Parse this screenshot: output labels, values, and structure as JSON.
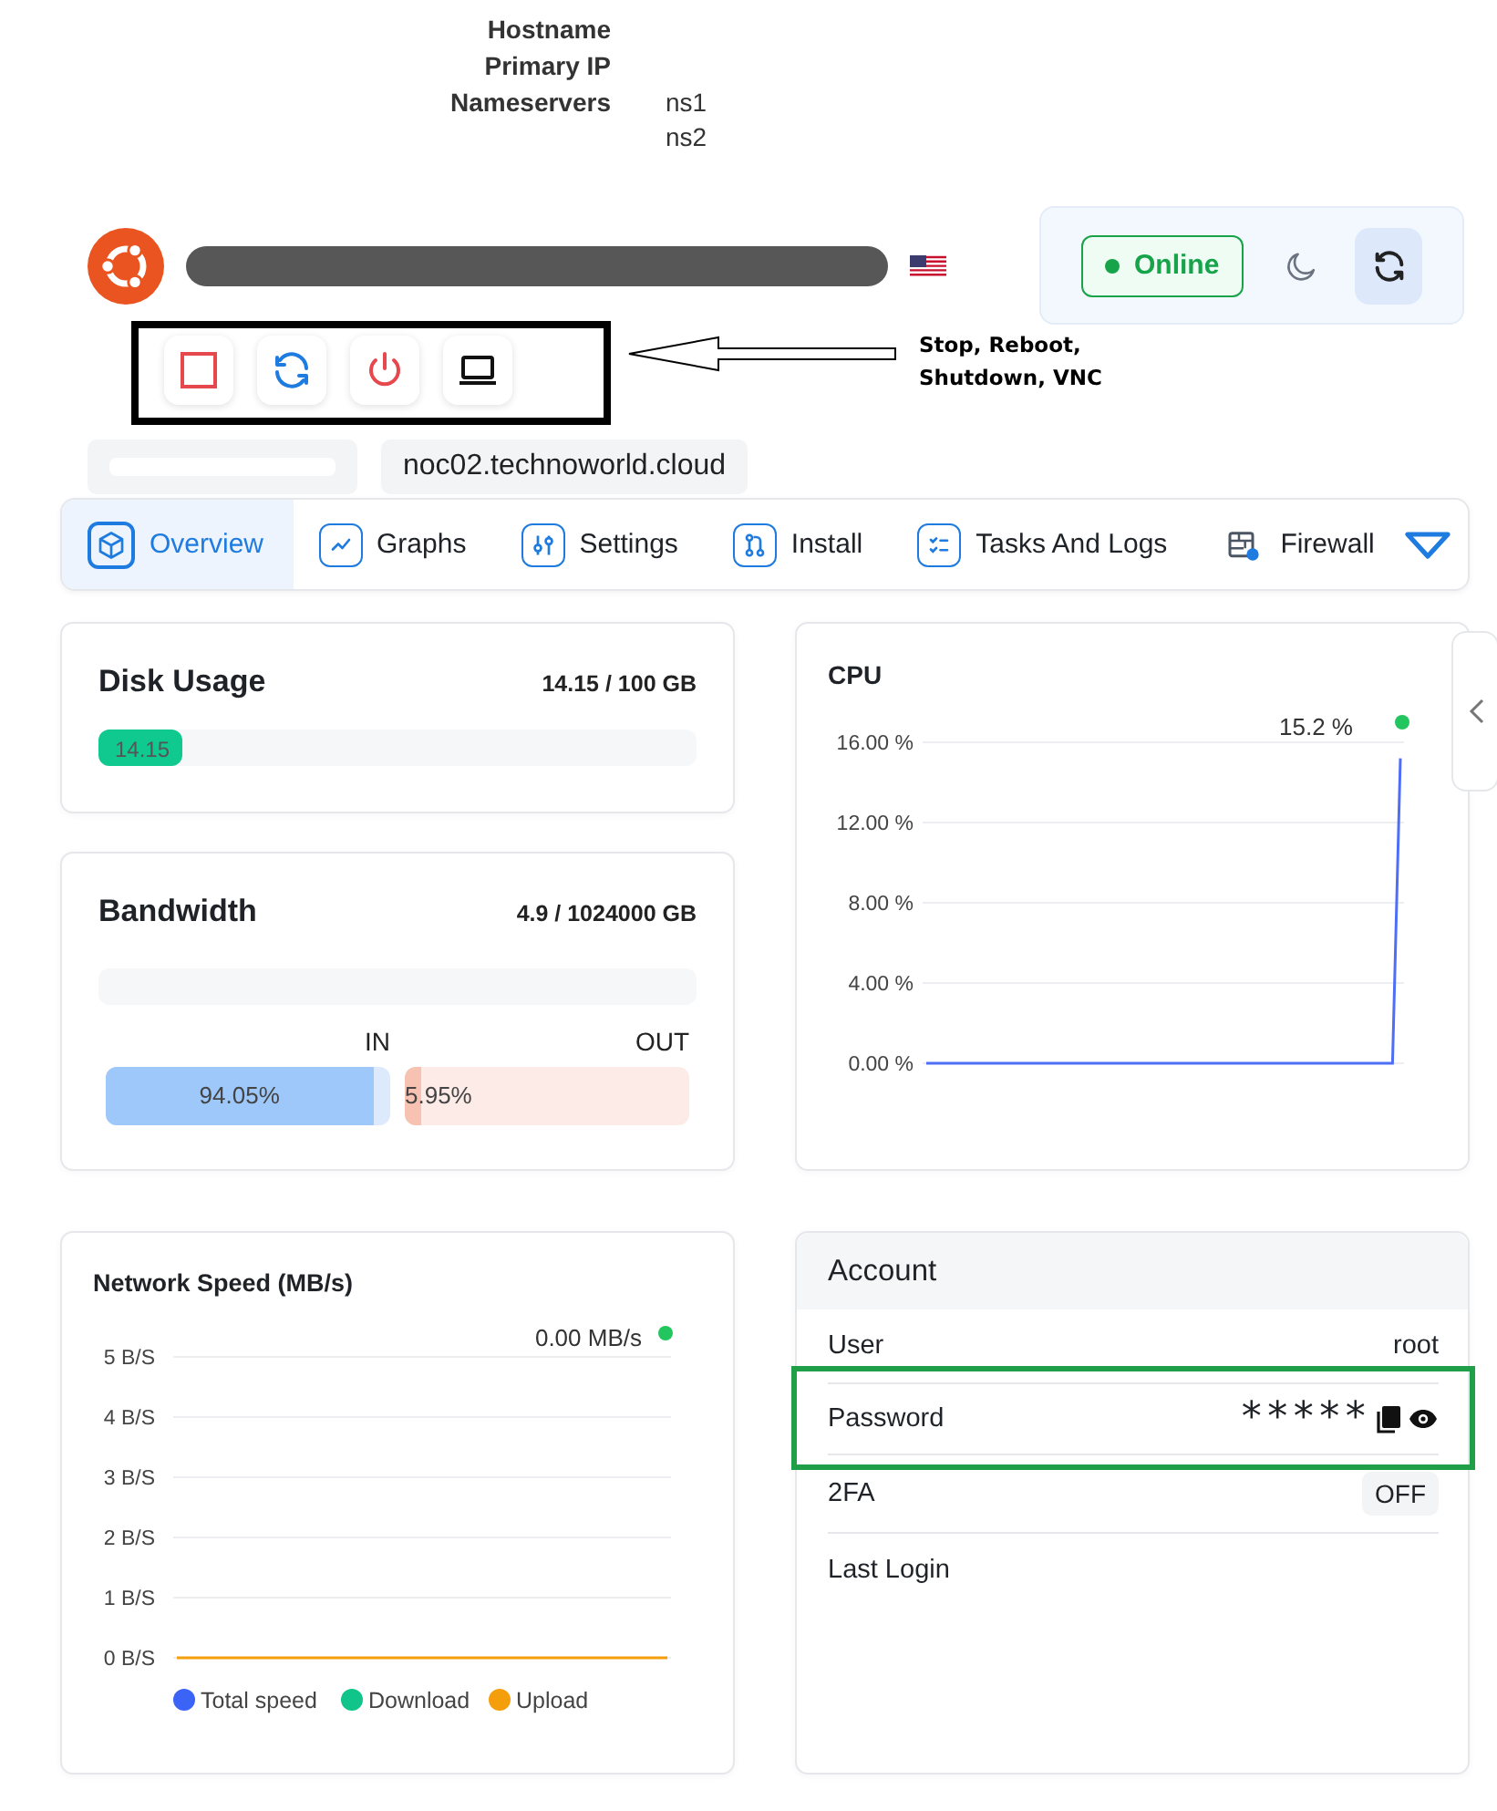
{
  "server_info": {
    "rows": [
      {
        "label": "Hostname"
      },
      {
        "label": "Primary IP"
      },
      {
        "label": "Nameservers",
        "values": [
          "ns1",
          "ns2"
        ]
      }
    ]
  },
  "status": {
    "label": "Online",
    "color": "#16a34a"
  },
  "actions": [
    {
      "kind": "stop"
    },
    {
      "kind": "reboot"
    },
    {
      "kind": "shutdown"
    },
    {
      "kind": "vnc"
    }
  ],
  "callout": {
    "text": "Stop, Reboot, Shutdown, VNC"
  },
  "chips": [
    {
      "text": "noc02.technoworld.cloud"
    }
  ],
  "tabs": [
    {
      "label": "Overview",
      "selected": true
    },
    {
      "label": "Graphs",
      "selected": false
    },
    {
      "label": "Settings",
      "selected": false
    },
    {
      "label": "Install",
      "selected": false
    },
    {
      "label": "Tasks And Logs",
      "selected": false
    },
    {
      "label": "Firewall",
      "selected": false
    }
  ],
  "disk": {
    "title": "Disk Usage",
    "reading": "14.15 / 100 GB",
    "level": 0.1415,
    "bar_label": "14.15"
  },
  "bandwidth": {
    "title": "Bandwidth",
    "reading": "4.9 / 1024000 GB",
    "in": {
      "label": "IN",
      "level": 0.9405,
      "reading": "94.05%"
    },
    "out": {
      "label": "OUT",
      "level": 0.0595,
      "reading": "5.95%"
    }
  },
  "cpu": {
    "title": "CPU",
    "reading": "15.2 %",
    "chart_data": {
      "type": "line",
      "grid": true,
      "ylim": [
        0,
        16
      ],
      "yticks": [
        {
          "value": 0,
          "label": "0.00 %"
        },
        {
          "value": 4,
          "label": "4.00 %"
        },
        {
          "value": 8,
          "label": "8.00 %"
        },
        {
          "value": 12,
          "label": "12.00 %"
        },
        {
          "value": 16,
          "label": "16.00 %"
        }
      ],
      "values": [
        0,
        0,
        0,
        0,
        0,
        0,
        0,
        0,
        0,
        0,
        0,
        0,
        0,
        0,
        0,
        0,
        0,
        0,
        0,
        0,
        0,
        0,
        0,
        0,
        0,
        0,
        0,
        0,
        0,
        0,
        0,
        0,
        0,
        0,
        0,
        0,
        0,
        0,
        0,
        0,
        0,
        0,
        0,
        0,
        0,
        0,
        0,
        0,
        0,
        0,
        0,
        0,
        0,
        0,
        0,
        0,
        0,
        0,
        0,
        0,
        15.2
      ]
    }
  },
  "network": {
    "title": "Network Speed (MB/s)",
    "reading": "0.00 MB/s",
    "chart_data": {
      "type": "line",
      "grid": true,
      "legend": true,
      "ylim": [
        0,
        5
      ],
      "yticks": [
        {
          "value": 0,
          "label": "0 B/S"
        },
        {
          "value": 1,
          "label": "1 B/S"
        },
        {
          "value": 2,
          "label": "2 B/S"
        },
        {
          "value": 3,
          "label": "3 B/S"
        },
        {
          "value": 4,
          "label": "4 B/S"
        },
        {
          "value": 5,
          "label": "5 B/S"
        }
      ],
      "series": [
        {
          "name": "Total speed",
          "color": "#3b63f6",
          "values": [
            null,
            null,
            null,
            null,
            null,
            null,
            null,
            null,
            null,
            null
          ]
        },
        {
          "name": "Download",
          "color": "#10c48a",
          "values": [
            null,
            null,
            null,
            null,
            null,
            null,
            null,
            null,
            null,
            null
          ]
        },
        {
          "name": "Upload",
          "color": "#f59e0b",
          "values": [
            0,
            0,
            0,
            0,
            0,
            0,
            0,
            0,
            0,
            0
          ]
        }
      ]
    }
  },
  "account": {
    "title": "Account",
    "rows": [
      {
        "kind": "text",
        "label": "User",
        "value": "root",
        "highlighted": false
      },
      {
        "kind": "secret",
        "label": "Password",
        "value": "*****",
        "highlighted": true
      },
      {
        "kind": "badge",
        "label": "2FA",
        "value": "OFF",
        "highlighted": false
      },
      {
        "kind": "text",
        "label": "Last Login",
        "highlighted": false
      }
    ]
  }
}
